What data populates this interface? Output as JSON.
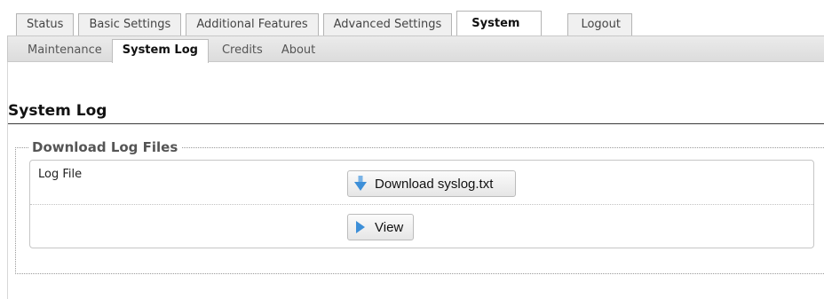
{
  "main_tabs": [
    {
      "label": "Status"
    },
    {
      "label": "Basic Settings"
    },
    {
      "label": "Additional Features"
    },
    {
      "label": "Advanced Settings"
    },
    {
      "label": "System",
      "active": true
    },
    {
      "label": "Logout"
    }
  ],
  "sub_tabs": [
    {
      "label": "Maintenance"
    },
    {
      "label": "System Log",
      "active": true
    },
    {
      "label": "Credits"
    },
    {
      "label": "About"
    }
  ],
  "page": {
    "title": "System Log"
  },
  "section": {
    "legend": "Download Log Files",
    "rows": [
      {
        "label": "Log File",
        "button_label": "Download syslog.txt",
        "button_icon": "download-arrow-icon"
      },
      {
        "label": "",
        "button_label": "View",
        "button_icon": "play-arrow-icon"
      }
    ]
  },
  "colors": {
    "icon_blue": "#3d8fd8",
    "rule": "#3a3a3a"
  }
}
